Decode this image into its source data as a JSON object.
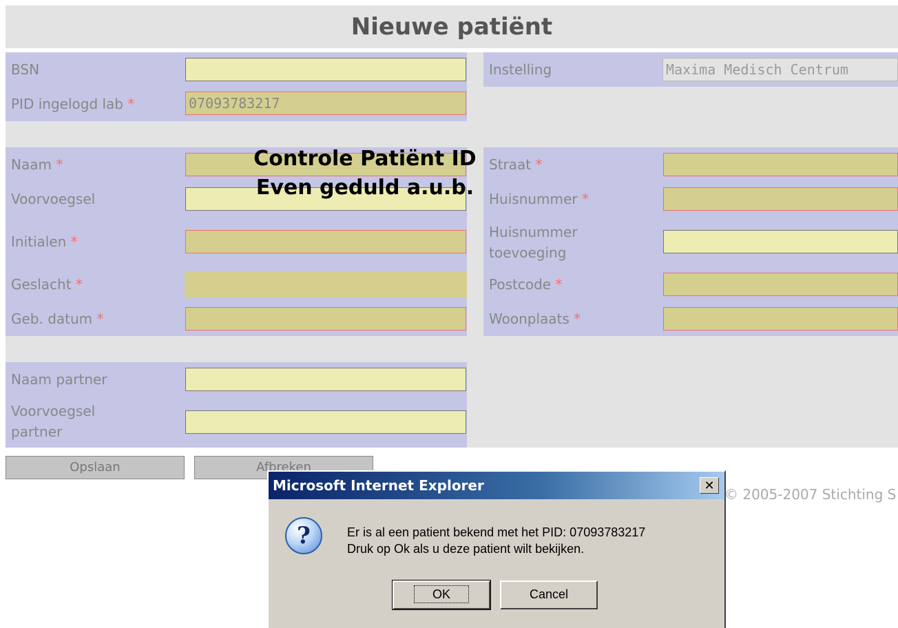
{
  "form": {
    "title": "Nieuwe patiënt",
    "required_marker": "*",
    "left": {
      "bsn": {
        "label": "BSN",
        "value": ""
      },
      "pid": {
        "label": "PID ingelogd lab",
        "value": "07093783217"
      },
      "naam": {
        "label": "Naam",
        "value": ""
      },
      "voorvoegsel": {
        "label": "Voorvoegsel",
        "value": ""
      },
      "initialen": {
        "label": "Initialen",
        "value": ""
      },
      "geslacht": {
        "label": "Geslacht",
        "value": ""
      },
      "geb_datum": {
        "label": "Geb. datum",
        "value": ""
      },
      "naam_partner": {
        "label": "Naam partner",
        "value": ""
      },
      "voorvoegsel_partner": {
        "label_line1": "Voorvoegsel",
        "label_line2": "partner",
        "value": ""
      }
    },
    "right": {
      "instelling": {
        "label": "Instelling",
        "value": "Maxima Medisch Centrum"
      },
      "straat": {
        "label": "Straat",
        "value": ""
      },
      "huisnummer": {
        "label": "Huisnummer",
        "value": ""
      },
      "toevoeging": {
        "label_line1": "Huisnummer",
        "label_line2": "toevoeging",
        "value": ""
      },
      "postcode": {
        "label": "Postcode",
        "value": ""
      },
      "woonplaats": {
        "label": "Woonplaats",
        "value": ""
      }
    },
    "buttons": {
      "save": "Opslaan",
      "cancel": "Afbreken"
    },
    "copyright": "© 2005-2007 Stichting S"
  },
  "overlay": {
    "line1": "Controle Patiënt ID",
    "line2": "Even geduld a.u.b."
  },
  "dialog": {
    "title": "Microsoft Internet Explorer",
    "close": "✕",
    "icon": "question-icon",
    "message_line1": "Er is al een patient bekend met het PID: 07093783217",
    "message_line2": "Druk op Ok als u deze patient wilt bekijken.",
    "ok": "OK",
    "cancel": "Cancel"
  },
  "colors": {
    "label_bg": "#c5c5e5",
    "gap_bg": "#e3e3e3",
    "required_field": "#d4cf8e",
    "optional_field": "#ededb3",
    "required_marker": "#ff6b6b"
  }
}
